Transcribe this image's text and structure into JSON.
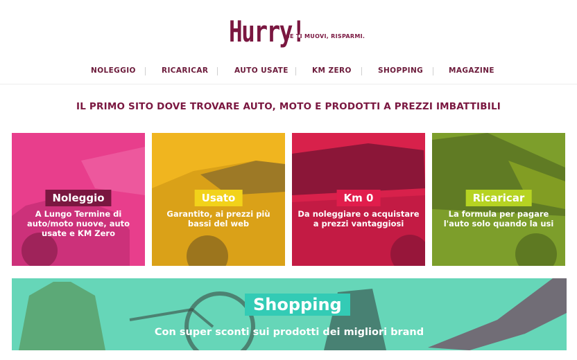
{
  "header": {
    "logo_text": "Hurry!",
    "logo_tagline": "SE TI MUOVI, RISPARMI."
  },
  "nav": {
    "items": [
      {
        "label": "NOLEGGIO"
      },
      {
        "label": "RICARICAR"
      },
      {
        "label": "AUTO USATE"
      },
      {
        "label": "KM ZERO"
      },
      {
        "label": "SHOPPING"
      },
      {
        "label": "MAGAZINE"
      }
    ]
  },
  "tagline": "IL PRIMO SITO DOVE TROVARE AUTO, MOTO E PRODOTTI A PREZZI IMBATTIBILI",
  "cards": [
    {
      "title": "Noleggio",
      "text": "A Lungo Termine di auto/moto nuove, auto usate e KM Zero",
      "badge_color": "#7a1740",
      "bg_color": "#e83e8c"
    },
    {
      "title": "Usato",
      "text": "Garantito, ai prezzi più bassi del web",
      "badge_color": "#f2d21a",
      "bg_color": "#f0b51f"
    },
    {
      "title": "Km 0",
      "text": "Da noleggiare o acquistare a prezzi vantaggiosi",
      "badge_color": "#e11d4c",
      "bg_color": "#d8214b"
    },
    {
      "title": "Ricaricar",
      "text": "La formula per pagare l'auto solo quando la usi",
      "badge_color": "#b6d322",
      "bg_color": "#7d9e2b"
    }
  ],
  "banner": {
    "title": "Shopping",
    "text": "Con super sconti sui prodotti dei migliori brand",
    "bg_color": "#66d6b8",
    "badge_color": "#33cbb5"
  }
}
